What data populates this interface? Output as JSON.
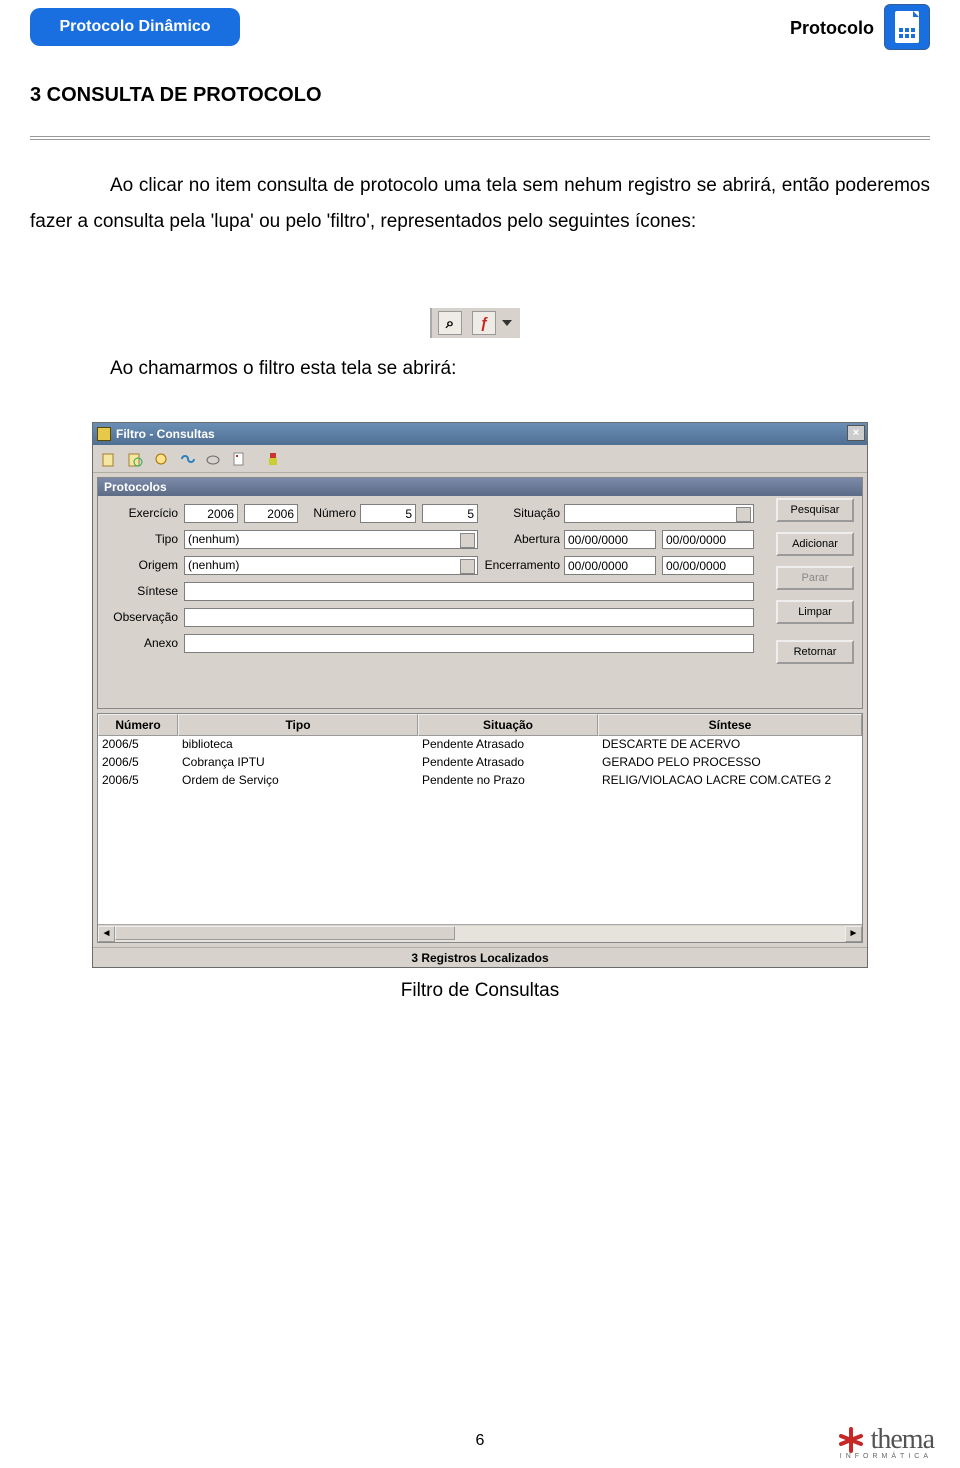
{
  "header": {
    "left_badge": "Protocolo Dinâmico",
    "right_text": "Protocolo"
  },
  "section_title": "3 CONSULTA DE PROTOCOLO",
  "para1": "Ao clicar no item consulta de protocolo uma tela sem nehum registro se abrirá, então poderemos fazer a consulta pela 'lupa' ou pelo 'filtro', representados pelo seguintes ícones:",
  "para2": "Ao chamarmos o filtro esta tela se abrirá:",
  "icon_lupa": "⌕",
  "icon_filter": "ƒ",
  "window": {
    "title": "Filtro - Consultas",
    "close": "×",
    "panel_title": "Protocolos",
    "labels": {
      "exercicio": "Exercício",
      "numero": "Número",
      "situacao": "Situação",
      "tipo": "Tipo",
      "abertura": "Abertura",
      "origem": "Origem",
      "encerramento": "Encerramento",
      "sintese": "Síntese",
      "observacao": "Observação",
      "anexo": "Anexo"
    },
    "values": {
      "exercicio1": "2006",
      "exercicio2": "2006",
      "numero1": "5",
      "numero2": "5",
      "situacao": "",
      "tipo": "(nenhum)",
      "abertura1": "00/00/0000",
      "abertura2": "00/00/0000",
      "origem": "(nenhum)",
      "encerr1": "00/00/0000",
      "encerr2": "00/00/0000",
      "sintese": "",
      "observacao": "",
      "anexo": ""
    },
    "buttons": {
      "pesquisar": "Pesquisar",
      "adicionar": "Adicionar",
      "parar": "Parar",
      "limpar": "Limpar",
      "retornar": "Retornar"
    },
    "columns": {
      "numero": "Número",
      "tipo": "Tipo",
      "situacao": "Situação",
      "sintese": "Síntese"
    },
    "rows": [
      {
        "numero": "2006/5",
        "tipo": "biblioteca",
        "situacao": "Pendente Atrasado",
        "sintese": "DESCARTE DE ACERVO"
      },
      {
        "numero": "2006/5",
        "tipo": "Cobrança IPTU",
        "situacao": "Pendente Atrasado",
        "sintese": "GERADO PELO PROCESSO"
      },
      {
        "numero": "2006/5",
        "tipo": "Ordem de Serviço",
        "situacao": "Pendente no Prazo",
        "sintese": "RELIG/VIOLACAO LACRE COM.CATEG 2"
      }
    ],
    "status": "3 Registros Localizados",
    "scroll_left": "◄",
    "scroll_right": "►"
  },
  "caption": "Filtro de Consultas",
  "pagenum": "6",
  "brand": "thema",
  "brand_sub": "INFORMÁTICA"
}
